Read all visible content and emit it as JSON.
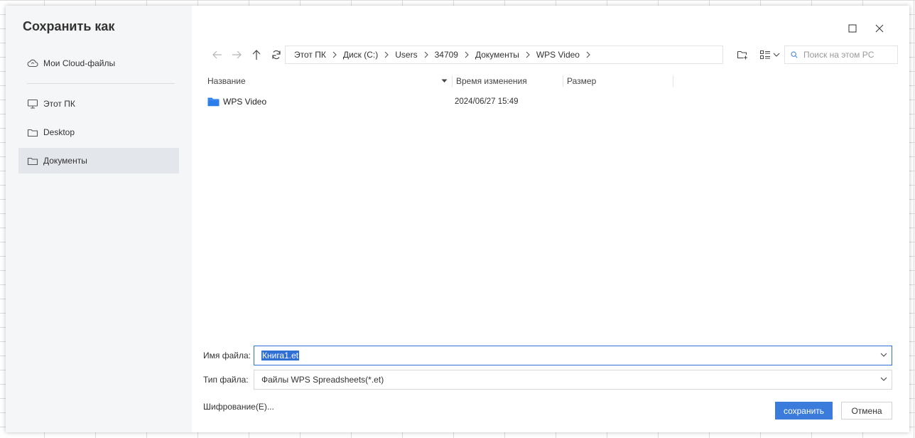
{
  "dialog": {
    "title": "Сохранить как"
  },
  "sidebar": {
    "items": [
      {
        "label": "Мои Cloud-файлы",
        "icon": "cloud-icon"
      },
      {
        "label": "Этот ПК",
        "icon": "monitor-icon"
      },
      {
        "label": "Desktop",
        "icon": "folder-icon"
      },
      {
        "label": "Документы",
        "icon": "folder-icon",
        "active": true
      }
    ]
  },
  "breadcrumb": [
    "Этот ПК",
    "Диск (C:)",
    "Users",
    "34709",
    "Документы",
    "WPS Video"
  ],
  "search": {
    "placeholder": "Поиск на этом PC"
  },
  "columns": {
    "name": "Название",
    "modified": "Время изменения",
    "size": "Размер"
  },
  "files": [
    {
      "name": "WPS Video",
      "modified": "2024/06/27 15:49",
      "size": "",
      "type": "folder"
    }
  ],
  "form": {
    "filename_label": "Имя файла:",
    "filename_value": "Книга1.et",
    "filetype_label": "Тип файла:",
    "filetype_value": "Файлы WPS Spreadsheets(*.et)"
  },
  "actions": {
    "encrypt_label": "Шифрование(E)...",
    "save_label": "сохранить",
    "cancel_label": "Отмена"
  },
  "colors": {
    "accent": "#3a7bdc",
    "folder": "#2b7de9",
    "sidebar_bg": "#f5f6f7",
    "active_item_bg": "#e3e6ea"
  }
}
